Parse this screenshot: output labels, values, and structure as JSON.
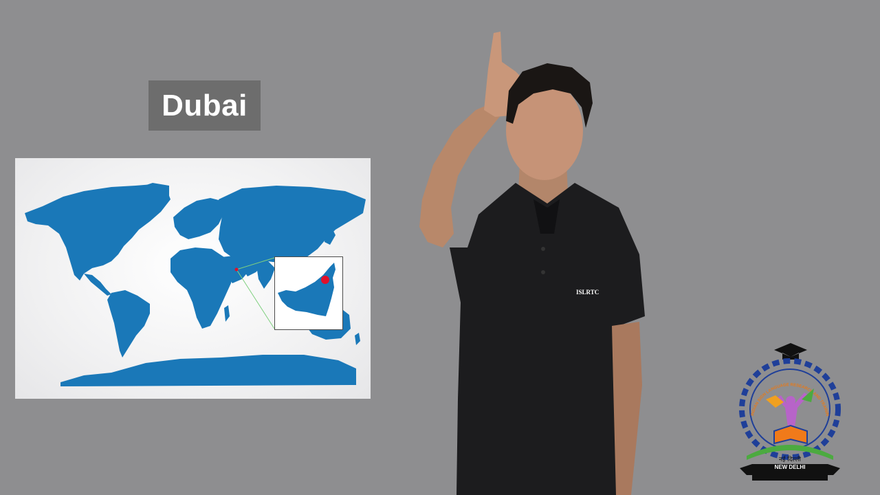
{
  "title": {
    "text": "Dubai"
  },
  "map": {
    "ocean_color": "#f4f4f5",
    "land_color": "#1a78b8",
    "marker_color": "#e0102a",
    "connector_color": "#7fd07f"
  },
  "signer": {
    "shirt_text": "ISLRTC"
  },
  "logo": {
    "hindi_text": "नई दिल्ली",
    "city_text": "NEW DELHI",
    "arc_text": "INDIAN SIGN LANGUAGE RESEARCH AND TRAINING CENTRE"
  }
}
